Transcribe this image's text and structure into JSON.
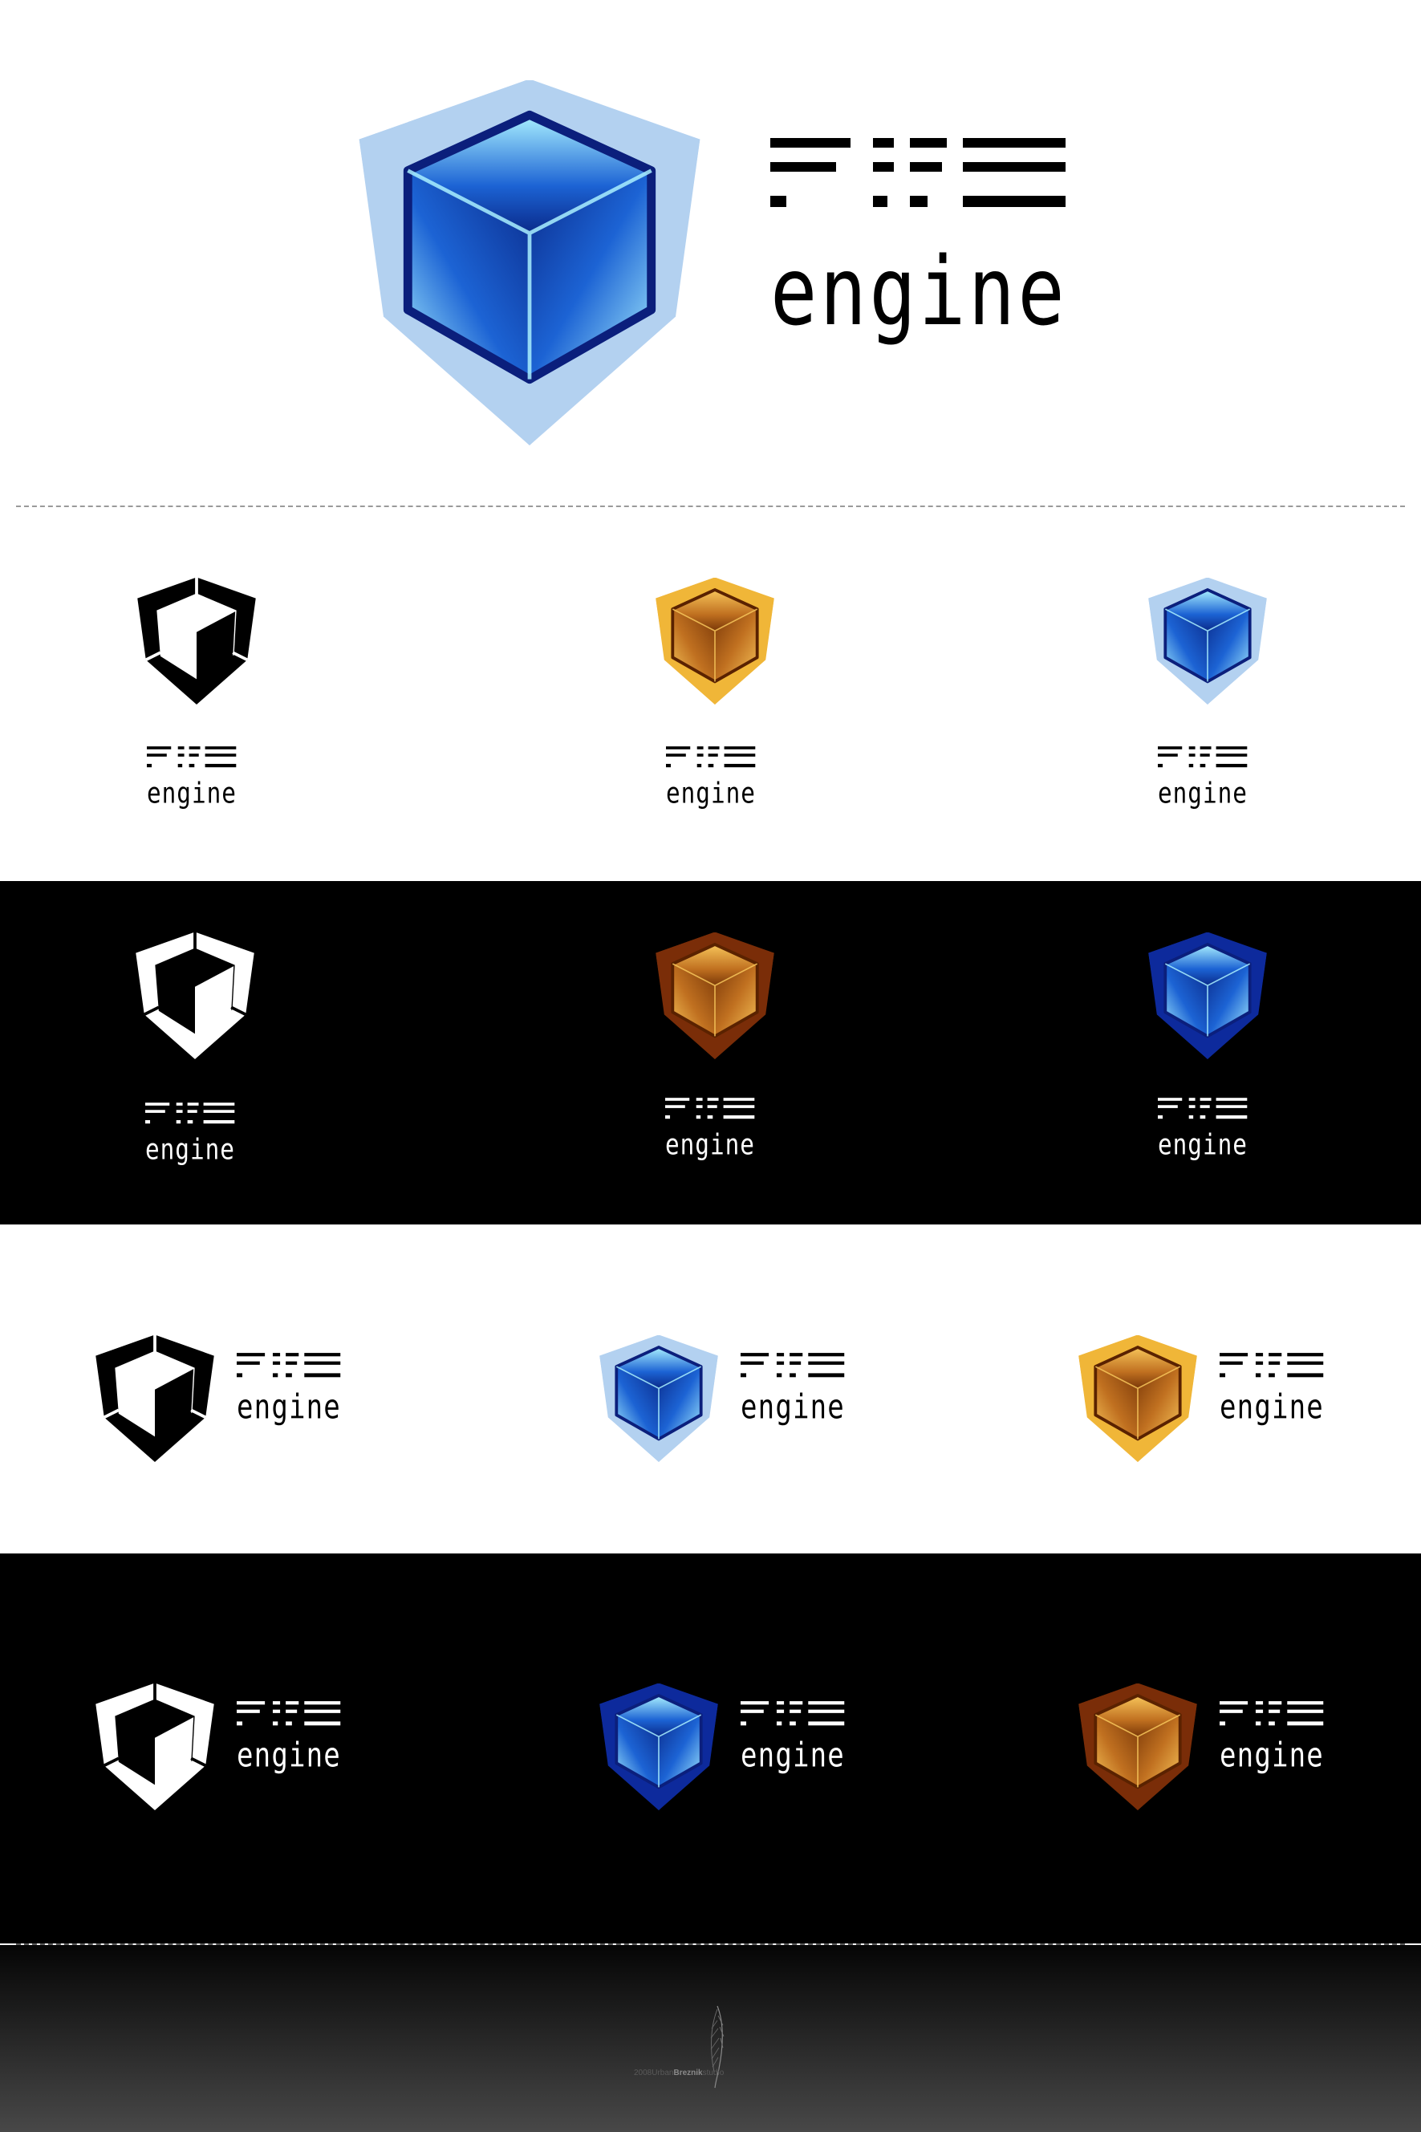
{
  "brand": {
    "wordmark_top": "FIFE",
    "wordmark_bottom": "engine"
  },
  "palettes": {
    "blue": {
      "shield": "#b3d1f0",
      "cube_light": "#a9f0ff",
      "cube_mid": "#1c63d4",
      "cube_dark": "#0a2a8a",
      "edge": "#0b1f7c"
    },
    "gold": {
      "shield": "#f0b638",
      "cube_light": "#f7c55a",
      "cube_mid": "#c07020",
      "cube_dark": "#7a3808",
      "edge": "#5a2200"
    },
    "blue_dark": {
      "shield": "#0d2a9c",
      "cube_light": "#a9f0ff",
      "cube_mid": "#1c63d4",
      "cube_dark": "#0a2a8a",
      "edge": "#0b1f7c"
    },
    "gold_dark": {
      "shield": "#7a2d08",
      "cube_light": "#f7c55a",
      "cube_mid": "#c07020",
      "cube_dark": "#7a3808",
      "edge": "#5a2200"
    }
  },
  "backgrounds": {
    "light": "#ffffff",
    "dark": "#000000",
    "footer_top": "#0a0a0a",
    "footer_bottom": "#4a4a4a"
  },
  "footer": {
    "watermark_year": "2008",
    "watermark_name": "Urban",
    "watermark_surname": "Breznik",
    "watermark_suffix": "studio"
  }
}
